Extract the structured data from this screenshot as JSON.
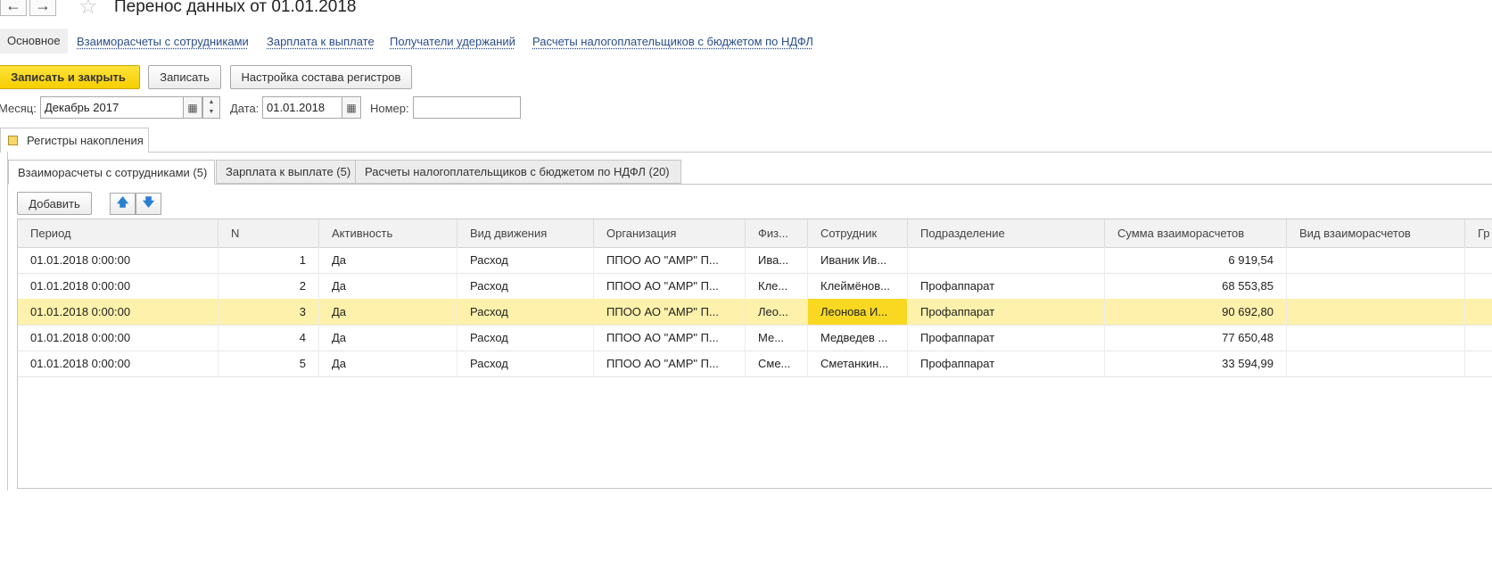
{
  "header": {
    "back_icon": "←",
    "forward_icon": "→",
    "favorite_icon": "☆",
    "title": "Перенос данных  от 01.01.2018"
  },
  "sections": [
    "Основное",
    "Взаиморасчеты с сотрудниками",
    "Зарплата к выплате",
    "Получатели удержаний",
    "Расчеты налогоплательщиков с бюджетом по НДФЛ"
  ],
  "toolbar": {
    "save_close": "Записать и закрыть",
    "save": "Записать",
    "setup": "Настройка состава регистров"
  },
  "form": {
    "month_label": "Месяц:",
    "month_value": "Декабрь 2017",
    "date_label": "Дата:",
    "date_value": "01.01.2018",
    "number_label": "Номер:",
    "number_value": ""
  },
  "page_tab": "Регистры накопления",
  "subtabs": [
    "Взаиморасчеты с сотрудниками (5)",
    "Зарплата к выплате (5)",
    "Расчеты налогоплательщиков с бюджетом по НДФЛ (20)"
  ],
  "table_toolbar": {
    "add": "Добавить",
    "up_icon": "🡅",
    "down_icon": "🡇"
  },
  "table": {
    "columns": [
      "Период",
      "N",
      "Активность",
      "Вид движения",
      "Организация",
      "Физ...",
      "Сотрудник",
      "Подразделение",
      "Сумма взаиморасчетов",
      "Вид взаиморасчетов",
      "Гр"
    ],
    "rows": [
      [
        "01.01.2018 0:00:00",
        "1",
        "Да",
        "Расход",
        "ППОО  АО \"АМР\"  П...",
        "Ива...",
        "Иваник Ив...",
        "",
        "6 919,54",
        "",
        ""
      ],
      [
        "01.01.2018 0:00:00",
        "2",
        "Да",
        "Расход",
        "ППОО  АО \"АМР\"  П...",
        "Кле...",
        "Клеймёнов...",
        "Профаппарат",
        "68 553,85",
        "",
        ""
      ],
      [
        "01.01.2018 0:00:00",
        "3",
        "Да",
        "Расход",
        "ППОО  АО \"АМР\"  П...",
        "Лео...",
        "Леонова И...",
        "Профаппарат",
        "90 692,80",
        "",
        ""
      ],
      [
        "01.01.2018 0:00:00",
        "4",
        "Да",
        "Расход",
        "ППОО  АО \"АМР\"  П...",
        "Ме...",
        "Медведев ...",
        "Профаппарат",
        "77 650,48",
        "",
        ""
      ],
      [
        "01.01.2018 0:00:00",
        "5",
        "Да",
        "Расход",
        "ППОО  АО \"АМР\"  П...",
        "Сме...",
        "Сметанкин...",
        "Профаппарат",
        "33 594,99",
        "",
        ""
      ]
    ],
    "selected_row": 3
  }
}
